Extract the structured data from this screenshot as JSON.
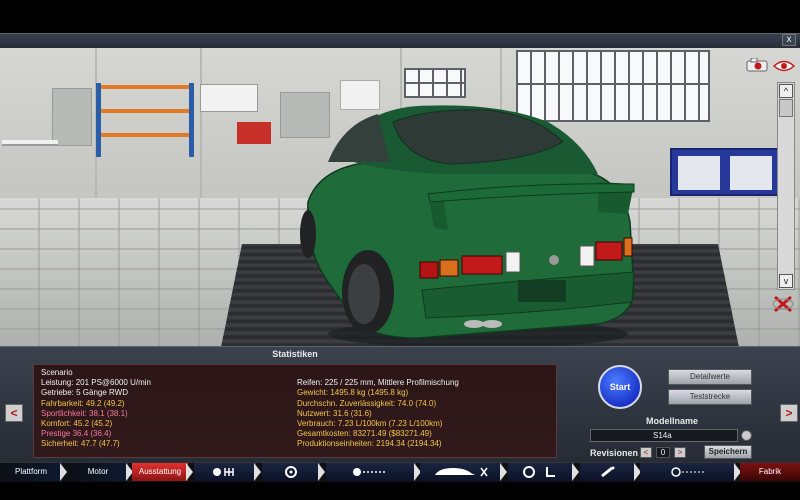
{
  "viewport": {
    "close_label": "x",
    "scroll_up": "^",
    "scroll_down": "v"
  },
  "stats": {
    "title": "Statistiken",
    "left_rows": [
      {
        "text": "Scenario",
        "color": "white"
      },
      {
        "text": "Leistung: 201 PS@6000 U/min",
        "color": "white"
      },
      {
        "text": "Getriebe: 5 Gänge RWD",
        "color": "white"
      },
      {
        "text": "Fahrbarkeit: 49.2 (49.2)",
        "color": "yellow"
      },
      {
        "text": "Sportlichkeit: 38.1 (38.1)",
        "color": "pink"
      },
      {
        "text": "Komfort: 45.2 (45.2)",
        "color": "yellow"
      },
      {
        "text": "Prestige 36.4 (36.4)",
        "color": "pink"
      },
      {
        "text": "Sicherheit: 47.7 (47.7)",
        "color": "yellow"
      }
    ],
    "right_rows": [
      {
        "text": "",
        "color": "white"
      },
      {
        "text": "Reifen: 225 / 225 mm, Mittlere Profilmischung",
        "color": "white"
      },
      {
        "text": "Gewicht: 1495.8 kg (1495.8 kg)",
        "color": "yellow"
      },
      {
        "text": "Durchschn. Zuverlässigkeit: 74.0 (74.0)",
        "color": "yellow"
      },
      {
        "text": "Nutzwert: 31.6 (31.6)",
        "color": "yellow"
      },
      {
        "text": "Verbrauch: 7.23 L/100km (7.23 L/100km)",
        "color": "yellow"
      },
      {
        "text": "Gesamtkosten: 83271.49 ($83271.49)",
        "color": "yellow"
      },
      {
        "text": "Produktionseinheiten: 2194.34 (2194.34)",
        "color": "yellow"
      }
    ]
  },
  "controls": {
    "start_label": "Start",
    "detail_label": "Detailwerte",
    "test_label": "Teststrecke",
    "model_name_label": "Modellname",
    "model_name_value": "S14a",
    "revision_label": "Revisionen",
    "revision_prev": "<",
    "revision_value": "0",
    "revision_next": ">",
    "save_label": "Speichern",
    "nav_prev": "<",
    "nav_next": ">"
  },
  "tabs": {
    "platform": "Plattform",
    "engine": "Motor",
    "equipment": "Ausstattung",
    "factory": "Fabrik"
  },
  "icons": {
    "camera": "camera-icon",
    "eye": "eye-icon",
    "rotate": "rotate-reset-icon",
    "clear": "clear-icon"
  },
  "colors": {
    "car_green": "#1f6b3a",
    "active_tab": "#e23030",
    "stat_yellow": "#f3c64a",
    "stat_pink": "#f57a9a",
    "start_blue": "#1a34c9"
  }
}
